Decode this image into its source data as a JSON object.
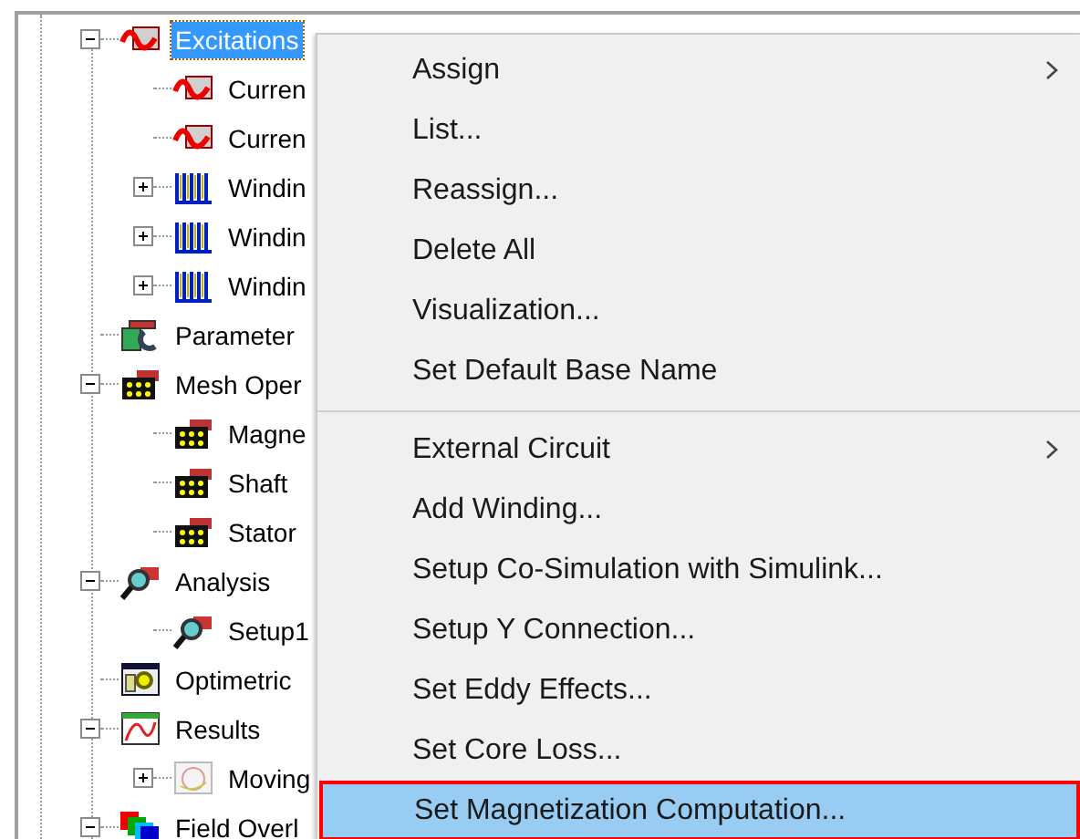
{
  "tree": [
    {
      "label": "Excitations",
      "kind": "excitation",
      "expanded": true,
      "selected": true,
      "children": [
        {
          "label": "Curren",
          "kind": "excitation",
          "selected": false
        },
        {
          "label": "Curren",
          "kind": "excitation",
          "selected": false
        },
        {
          "label": "Windin",
          "kind": "winding",
          "expanded": false,
          "selected": false
        },
        {
          "label": "Windin",
          "kind": "winding",
          "expanded": false,
          "selected": false
        },
        {
          "label": "Windin",
          "kind": "winding",
          "expanded": false,
          "selected": false
        }
      ]
    },
    {
      "label": "Parameter",
      "kind": "parameter",
      "selected": false
    },
    {
      "label": "Mesh Oper",
      "kind": "mesh",
      "expanded": true,
      "selected": false,
      "children": [
        {
          "label": "Magne",
          "kind": "mesh",
          "selected": false
        },
        {
          "label": "Shaft",
          "kind": "mesh",
          "selected": false
        },
        {
          "label": "Stator",
          "kind": "mesh",
          "selected": false
        }
      ]
    },
    {
      "label": "Analysis",
      "kind": "analysis",
      "expanded": true,
      "selected": false,
      "children": [
        {
          "label": "Setup1",
          "kind": "analysis",
          "selected": false
        }
      ]
    },
    {
      "label": "Optimetric",
      "kind": "optimetrics",
      "selected": false
    },
    {
      "label": "Results",
      "kind": "results",
      "expanded": true,
      "selected": false,
      "children": [
        {
          "label": "Moving",
          "kind": "plot",
          "expanded": false,
          "selected": false
        }
      ]
    },
    {
      "label": "Field Overl",
      "kind": "overlay",
      "expanded": true,
      "selected": false
    }
  ],
  "context_menu": [
    {
      "kind": "item",
      "label": "Assign",
      "submenu": true,
      "selected": false
    },
    {
      "kind": "item",
      "label": "List...",
      "submenu": false,
      "selected": false
    },
    {
      "kind": "item",
      "label": "Reassign...",
      "submenu": false,
      "selected": false
    },
    {
      "kind": "item",
      "label": "Delete All",
      "submenu": false,
      "selected": false
    },
    {
      "kind": "item",
      "label": "Visualization...",
      "submenu": false,
      "selected": false
    },
    {
      "kind": "item",
      "label": "Set Default Base Name",
      "submenu": false,
      "selected": false
    },
    {
      "kind": "separator"
    },
    {
      "kind": "item",
      "label": "External Circuit",
      "submenu": true,
      "selected": false
    },
    {
      "kind": "item",
      "label": "Add Winding...",
      "submenu": false,
      "selected": false
    },
    {
      "kind": "item",
      "label": "Setup Co-Simulation with Simulink...",
      "submenu": false,
      "selected": false
    },
    {
      "kind": "item",
      "label": "Setup Y Connection...",
      "submenu": false,
      "selected": false
    },
    {
      "kind": "item",
      "label": "Set Eddy Effects...",
      "submenu": false,
      "selected": false
    },
    {
      "kind": "item",
      "label": "Set Core Loss...",
      "submenu": false,
      "selected": false
    },
    {
      "kind": "item",
      "label": "Set Magnetization Computation...",
      "submenu": false,
      "selected": true
    }
  ]
}
